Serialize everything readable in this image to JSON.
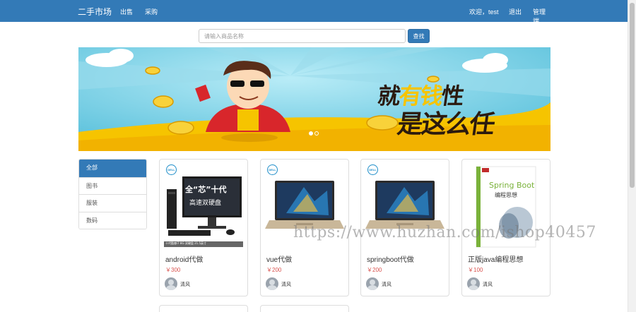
{
  "nav": {
    "brand": "二手市场",
    "sell": "出售",
    "buy": "采购",
    "welcome": "欢迎，test",
    "logout": "退出",
    "admin": "管理端"
  },
  "search": {
    "placeholder": "请输入商品名称",
    "button": "查找"
  },
  "banner": {
    "line1_a": "就",
    "line1_b": "有钱",
    "line1_c": "性",
    "line2": "是这么任",
    "slide_count": 2,
    "active_slide": 1
  },
  "categories": [
    {
      "label": "全部",
      "active": true
    },
    {
      "label": "图书",
      "active": false
    },
    {
      "label": "服装",
      "active": false
    },
    {
      "label": "数码",
      "active": false
    }
  ],
  "products": [
    {
      "title": "android代做",
      "price": "￥300",
      "seller": "清风",
      "image": "desktop-pc",
      "promo_1": "全“芯”十代",
      "promo_2": "高速双硬盘",
      "promo_3": "十代酷睿i7 8G 双硬盘 21.5英寸"
    },
    {
      "title": "vue代做",
      "price": "￥200",
      "seller": "清风",
      "image": "laptop"
    },
    {
      "title": "springboot代做",
      "price": "￥200",
      "seller": "清风",
      "image": "laptop"
    },
    {
      "title": "正版java编程思想",
      "price": "￥100",
      "seller": "清风",
      "image": "book",
      "book_title": "Spring Boot",
      "book_subtitle": "编程思想"
    }
  ],
  "dell_logo": "DELL",
  "watermark": "https://www.huzhan.com/ishop40457",
  "colors": {
    "primary": "#337ab7",
    "price": "#d9534f",
    "banner_sky": "#7fd0e6",
    "banner_ground": "#f6c400"
  }
}
